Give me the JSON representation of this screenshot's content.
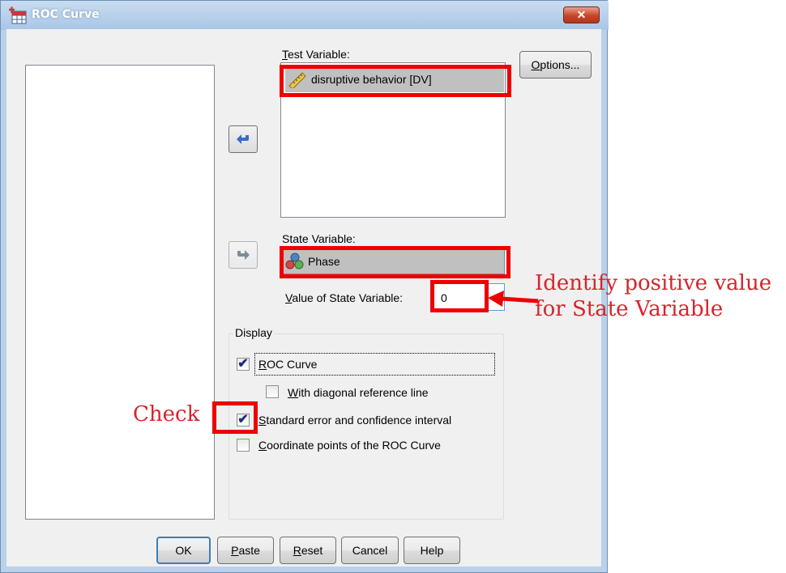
{
  "window": {
    "title": "ROC Curve",
    "close_glyph": "✕"
  },
  "test_variable": {
    "label_u": "T",
    "label_rest": "est Variable:",
    "items": [
      {
        "label": "disruptive behavior [DV]",
        "icon": "ruler-scale-icon"
      }
    ]
  },
  "state_variable": {
    "label": "State Variable:",
    "items": [
      {
        "label": "Phase",
        "icon": "nominal-variable-icon"
      }
    ],
    "value_label_u": "V",
    "value_label_rest": "alue of State Variable:",
    "value": "0"
  },
  "buttons": {
    "options_u": "O",
    "options_rest": "ptions...",
    "ok": "OK",
    "paste_u": "P",
    "paste_rest": "aste",
    "reset_u": "R",
    "reset_rest": "eset",
    "cancel": "Cancel",
    "help": "Help"
  },
  "display": {
    "legend": "Display",
    "roc_curve": {
      "u": "R",
      "rest": "OC Curve",
      "checked": true
    },
    "diagonal_line": {
      "u": "W",
      "rest": "ith diagonal reference line",
      "checked": false
    },
    "std_error": {
      "u": "S",
      "rest": "tandard error and confidence interval",
      "checked": true
    },
    "coordinate_points": {
      "u": "C",
      "rest": "oordinate points of the ROC Curve",
      "checked": false
    }
  },
  "annotations": {
    "identify_line1": "Identify positive value",
    "identify_line2": "for State Variable",
    "check": "Check",
    "color": "#d8232a"
  },
  "colors": {
    "titlebar": "#b9d1ea",
    "highlight_red": "#ee0000",
    "arrow_blue": "#3a6bc9"
  }
}
